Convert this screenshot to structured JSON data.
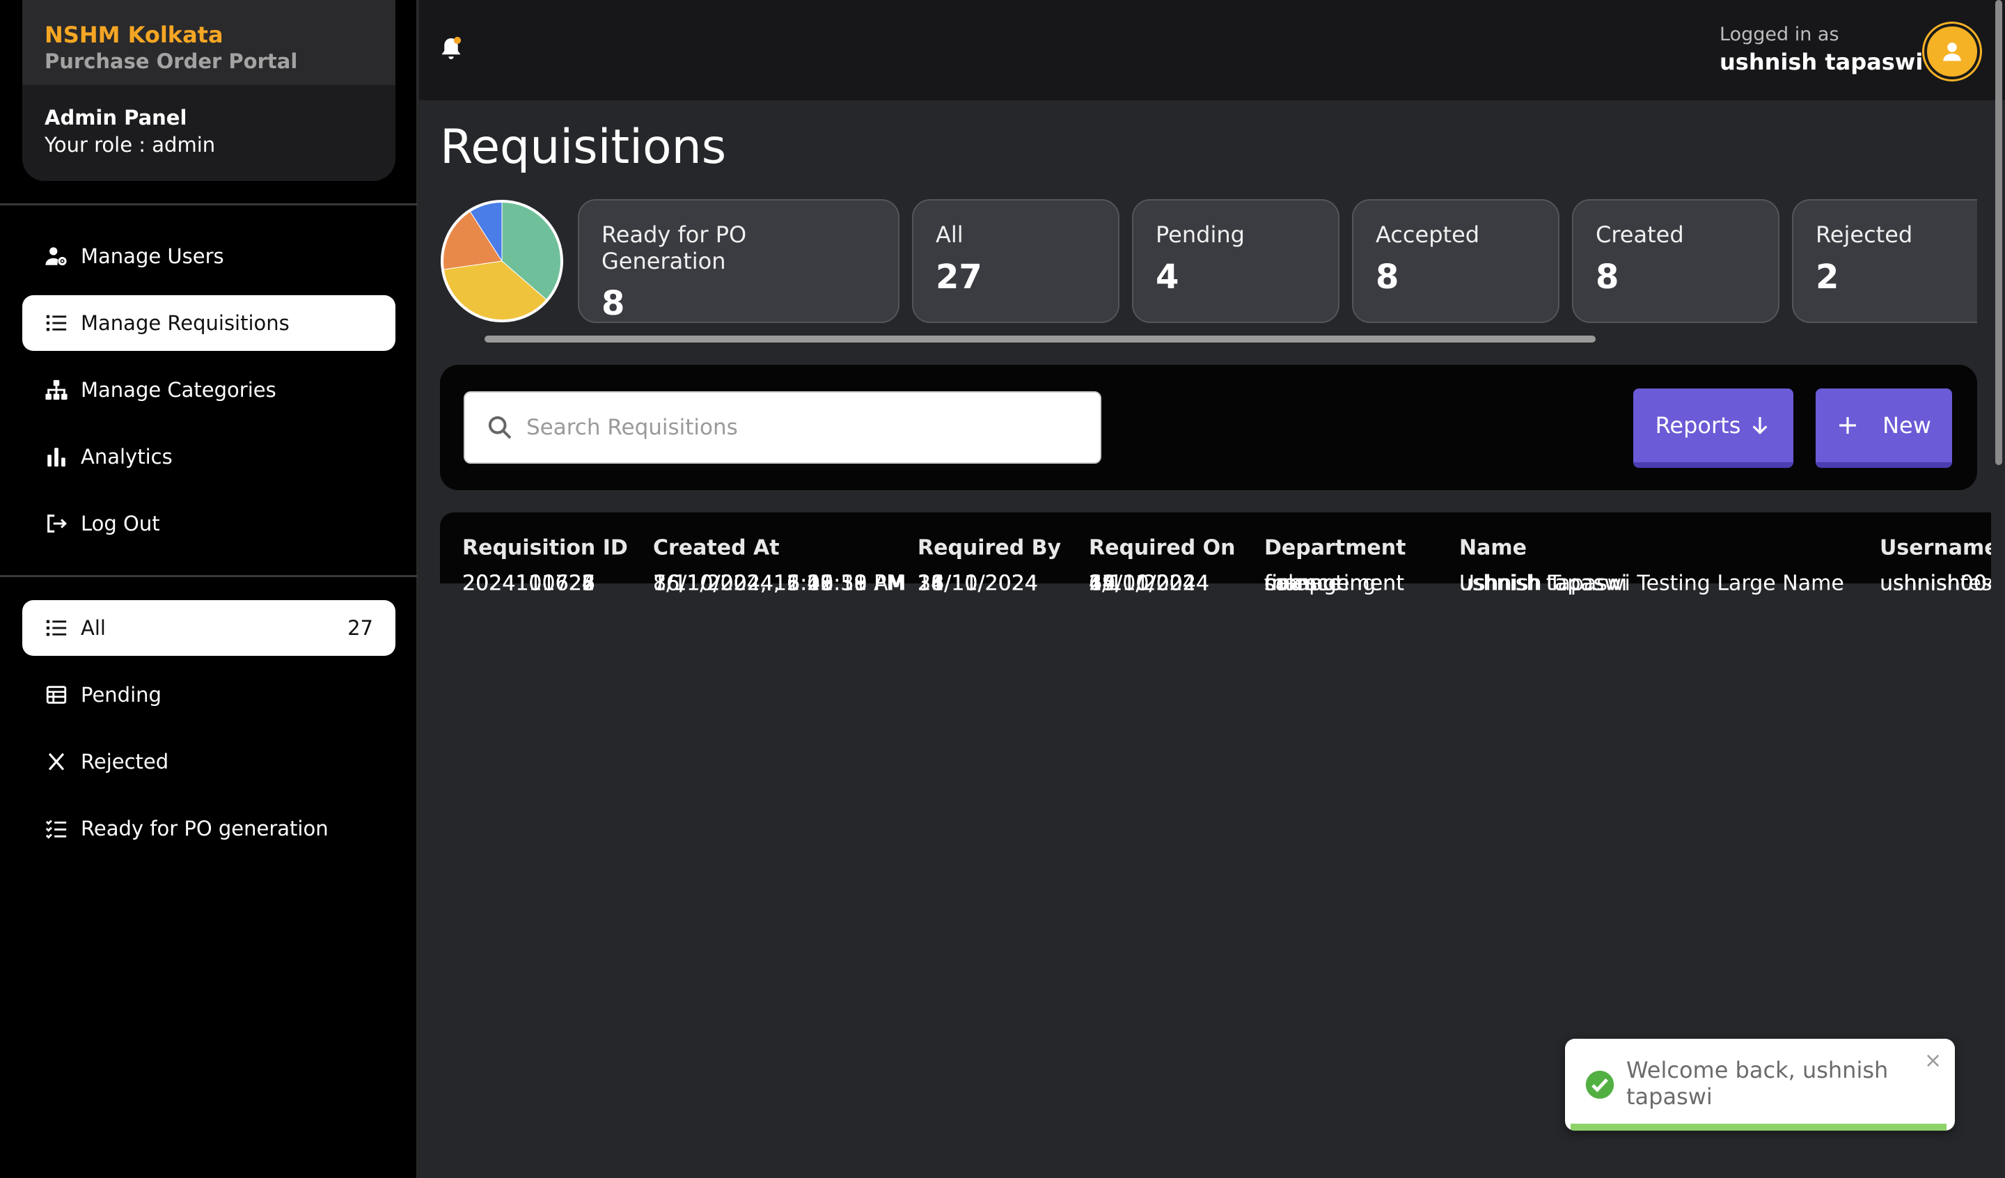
{
  "sidebar": {
    "brand_name": "NSHM Kolkata",
    "brand_subtitle": "Purchase Order Portal",
    "panel_title": "Admin Panel",
    "panel_role": "Your role : admin",
    "main_nav": [
      {
        "label": "Manage Users",
        "icon": "user-gear-icon"
      },
      {
        "label": "Manage Requisitions",
        "icon": "list-icon",
        "active": true
      },
      {
        "label": "Manage Categories",
        "icon": "sitemap-icon"
      },
      {
        "label": "Analytics",
        "icon": "bar-chart-icon"
      },
      {
        "label": "Log Out",
        "icon": "logout-icon"
      }
    ],
    "filters": [
      {
        "label": "All",
        "count": "27",
        "icon": "list-icon",
        "active": true
      },
      {
        "label": "Pending",
        "icon": "table-icon"
      },
      {
        "label": "Rejected",
        "icon": "x-icon"
      },
      {
        "label": "Ready for PO generation",
        "icon": "checklist-icon"
      }
    ]
  },
  "header": {
    "logged_label": "Logged in as",
    "username": "ushnish tapaswi",
    "bell_icon": "bell-icon",
    "avatar_icon": "user-icon"
  },
  "page": {
    "title": "Requisitions"
  },
  "stats": {
    "cards": [
      {
        "label": "Ready for PO Generation",
        "value": "8"
      },
      {
        "label": "All",
        "value": "27"
      },
      {
        "label": "Pending",
        "value": "4"
      },
      {
        "label": "Accepted",
        "value": "8"
      },
      {
        "label": "Created",
        "value": "8"
      },
      {
        "label": "Rejected",
        "value": "2"
      }
    ],
    "pie": {
      "slices": [
        {
          "name": "Accepted",
          "value": 8,
          "color": "#6fc09a"
        },
        {
          "name": "Created",
          "value": 8,
          "color": "#f0c33c"
        },
        {
          "name": "Pending",
          "value": 4,
          "color": "#e8894a"
        },
        {
          "name": "Rejected",
          "value": 2,
          "color": "#4a7de8"
        }
      ]
    }
  },
  "toolbar": {
    "search_placeholder": "Search Requisitions",
    "reports_label": "Reports",
    "new_label": "New"
  },
  "table": {
    "columns": [
      "Requisition ID",
      "Created At",
      "Required By",
      "Required On",
      "Department",
      "Name",
      "Username"
    ],
    "rows": [
      [
        "2024110728",
        "8/11/2024, 12:48:58 AM",
        "28/11/2024",
        "29/11/2024",
        "finance",
        "ushnish tapaswi",
        "ushnish004"
      ],
      [
        "2024110727",
        "7/11/2024, 11:03:51 PM",
        "16/11/2024",
        "15/11/2024",
        "sales",
        "Ushnish Tapaswi Testing Large Name",
        "ushnishtest"
      ],
      [
        "2024101626",
        "16/10/2024, 6:26:59 PM",
        "26/10/2024",
        "24/10/2024",
        "finance",
        "ushnish tapaswi",
        "ushnish004"
      ],
      [
        "2024101625",
        "16/10/2024, 6:21:19 PM",
        "14/11/2024",
        "6/11/2024",
        "finance",
        "ushnish tapaswi",
        "ushnish004"
      ],
      [
        "2024101624",
        "16/10/2024, 6:12:19 PM",
        "18/10/2024",
        "4/10/2024",
        "management",
        "ushnish tapaswi",
        "ushnish004"
      ],
      [
        "2024101623",
        "16/10/2024, 5:20:30 PM",
        "31/10/2024",
        "19/10/2024",
        "computing",
        "ushnish tapaswi",
        "ushnish004"
      ],
      [
        "2024101622",
        "16/10/2024, 5:19:10 PM",
        "18/10/2024",
        "17/10/2024",
        "management",
        "ushnish tapaswi",
        "ushnish004"
      ]
    ]
  },
  "toast": {
    "message": "Welcome back, ushnish tapaswi",
    "close": "×"
  }
}
